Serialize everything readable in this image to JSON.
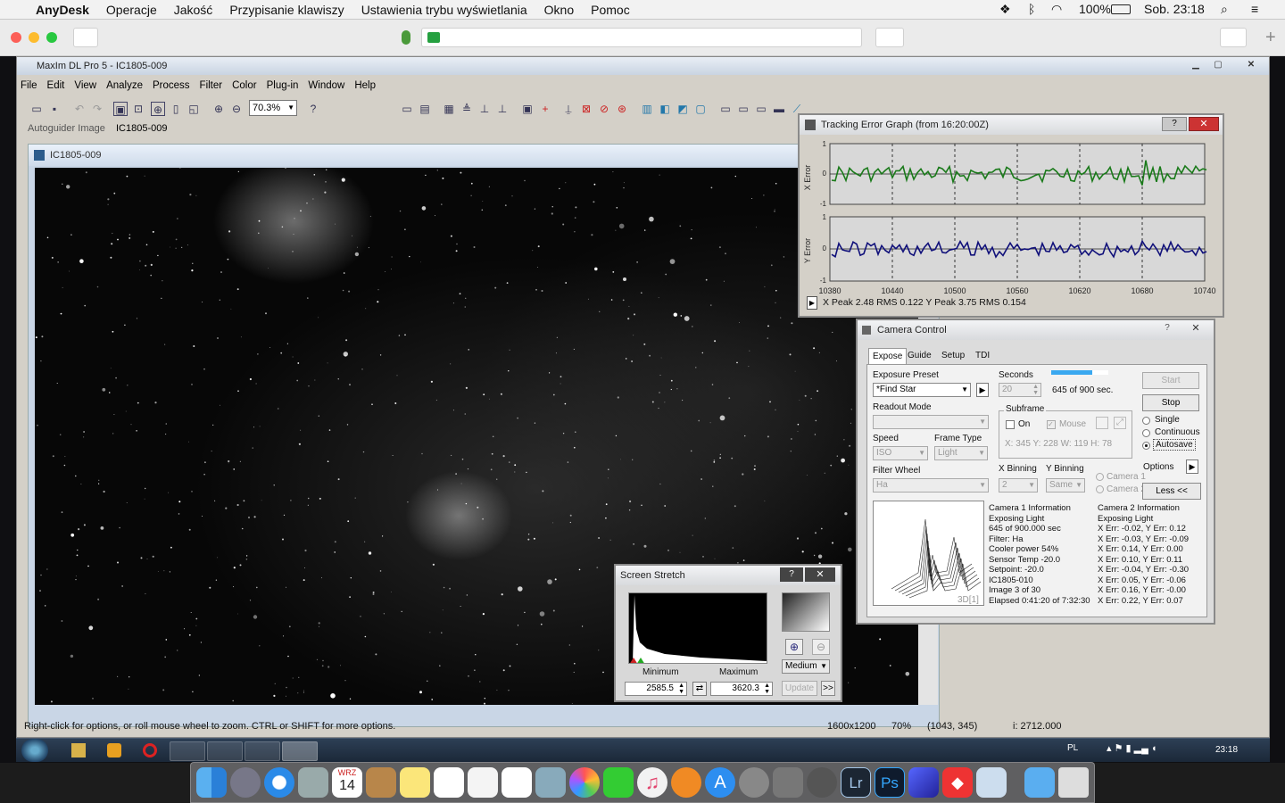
{
  "mac_menubar": {
    "app_name": "AnyDesk",
    "items": [
      "Operacje",
      "Jakość",
      "Przypisanie klawiszy",
      "Ustawienia trybu wyświetlania",
      "Okno",
      "Pomoc"
    ],
    "battery": "100%",
    "datetime": "Sob. 23:18"
  },
  "maxim": {
    "title": "MaxIm DL Pro 5 - IC1805-009",
    "menu": [
      "File",
      "Edit",
      "View",
      "Analyze",
      "Process",
      "Filter",
      "Color",
      "Plug-in",
      "Window",
      "Help"
    ],
    "zoom": "70.3%",
    "autoguider_label": "Autoguider Image",
    "autoguider_name": "IC1805-009",
    "image_window_title": "IC1805-009",
    "status": {
      "hint": "Right-click for options, or roll mouse wheel to zoom. CTRL or SHIFT for more options.",
      "dimensions": "1600x1200",
      "zoom": "70%",
      "coords": "(1043, 345)",
      "intensity": "i: 2712.000"
    }
  },
  "tracking": {
    "title": "Tracking Error Graph (from 16:20:00Z)",
    "x_label": "X Error",
    "y_label": "Y Error",
    "y_ticks": [
      "1",
      "0",
      "-1"
    ],
    "x_ticks": [
      "10380",
      "10440",
      "10500",
      "10560",
      "10620",
      "10680",
      "10740"
    ],
    "status": "X Peak 2.48   RMS 0.122   Y Peak 3.75   RMS 0.154",
    "x_color": "#1a7a1a",
    "y_color": "#10107a"
  },
  "camera": {
    "title": "Camera Control",
    "tabs": [
      "Expose",
      "Guide",
      "Setup",
      "TDI"
    ],
    "exposure_preset_label": "Exposure Preset",
    "exposure_preset_value": "*Find Star",
    "seconds_label": "Seconds",
    "seconds_value": "20",
    "progress_text": "645 of 900 sec.",
    "progress_fraction": 0.717,
    "readout_label": "Readout Mode",
    "speed_label": "Speed",
    "speed_value": "ISO",
    "frame_type_label": "Frame Type",
    "frame_type_value": "Light",
    "filter_wheel_label": "Filter Wheel",
    "filter_value": "Ha",
    "subframe_label": "Subframe",
    "on_label": "On",
    "mouse_label": "Mouse",
    "subframe_coords": "X: 345 Y: 228 W: 119 H:  78",
    "xbin_label": "X Binning",
    "xbin_value": "2",
    "ybin_label": "Y Binning",
    "ybin_value": "Same",
    "camera1_radio": "Camera 1",
    "camera2_radio": "Camera 2",
    "start_label": "Start",
    "stop_label": "Stop",
    "single_label": "Single",
    "continuous_label": "Continuous",
    "autosave_label": "Autosave",
    "options_label": "Options",
    "less_label": "Less <<",
    "graph_label": "3D[1]",
    "cam1_info": [
      "Camera 1 Information",
      "Exposing Light",
      "645 of 900.000 sec",
      "Filter: Ha",
      "Cooler power 54%",
      "Sensor Temp -20.0",
      "Setpoint: -20.0",
      "IC1805-010",
      "Image 3 of 30",
      "Elapsed 0:41:20 of 7:32:30"
    ],
    "cam2_info": [
      "Camera 2 Information",
      "Exposing Light",
      "X Err: -0.02, Y Err: 0.12",
      "X Err: -0.03, Y Err: -0.09",
      "X Err: 0.14, Y Err: 0.00",
      "X Err: 0.10, Y Err: 0.11",
      "X Err: -0.04, Y Err: -0.30",
      "X Err: 0.05, Y Err: -0.06",
      "X Err: 0.16, Y Err: -0.00",
      "X Err: 0.22, Y Err: 0.07"
    ]
  },
  "stretch": {
    "title": "Screen Stretch",
    "min_label": "Minimum",
    "max_label": "Maximum",
    "min_value": "2585.5",
    "max_value": "3620.3",
    "mode": "Medium",
    "update_label": "Update",
    "more_label": ">>"
  },
  "taskbar": {
    "lang": "PL",
    "time": "23:18"
  },
  "dock": {
    "calendar_month": "WRZ",
    "calendar_day": "14",
    "lr_label": "Lr",
    "ps_label": "Ps"
  }
}
